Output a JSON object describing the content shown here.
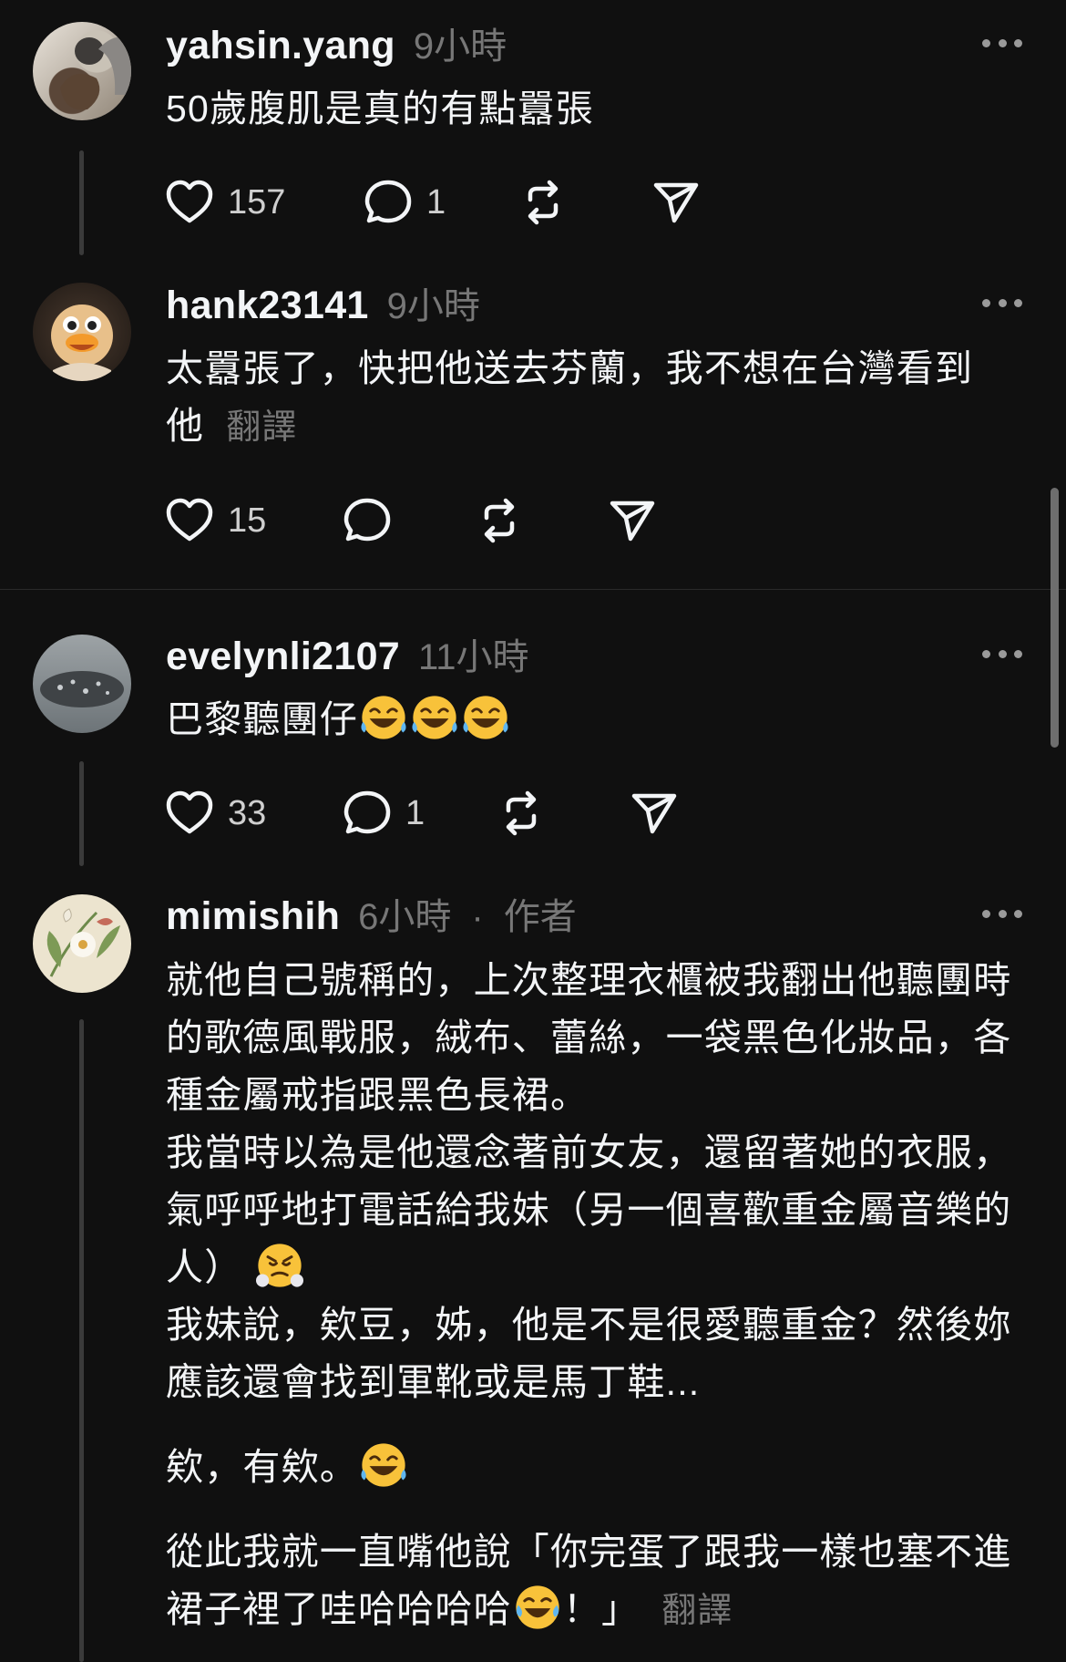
{
  "posts": [
    {
      "username": "yahsin.yang",
      "time": "9小時",
      "lines": [
        "50歲腹肌是真的有點囂張"
      ],
      "likes": "157",
      "replies": "1"
    },
    {
      "username": "hank23141",
      "time": "9小時",
      "lines": [
        "太囂張了，快把他送去芬蘭，我不想在台灣看到",
        "他"
      ],
      "translate": "翻譯",
      "likes": "15",
      "replies": ""
    },
    {
      "username": "evelynli2107",
      "time": "11小時",
      "lines": [
        "巴黎聽團仔"
      ],
      "likes": "33",
      "replies": "1"
    },
    {
      "username": "mimishih",
      "time": "6小時",
      "separator": "·",
      "author_badge": "作者",
      "lines": [
        "就他自己號稱的，上次整理衣櫃被我翻出他聽團時",
        "的歌德風戰服，絨布、蕾絲，一袋黑色化妝品，各",
        "種金屬戒指跟黑色長裙。",
        "我當時以為是他還念著前女友，還留著她的衣服，",
        "氣呼呼地打電話給我妹（另一個喜歡重金屬音樂的",
        "人）",
        "我妹說，欸豆，姊，他是不是很愛聽重金？然後妳",
        "應該還會找到軍靴或是馬丁鞋...",
        "欸，有欸。",
        "從此我就一直嘴他說「你完蛋了跟我一樣也塞不進",
        "裙子裡了哇哈哈哈哈",
        "！」"
      ],
      "translate": "翻譯"
    }
  ],
  "icons": {
    "like": "heart-icon",
    "reply": "comment-icon",
    "repost": "repost-icon",
    "share": "send-icon",
    "more": "more-icon",
    "emoji_laugh": "rolling-laughing-emoji",
    "emoji_huff": "huffing-emoji",
    "emoji_tears": "tears-of-joy-emoji"
  },
  "colors": {
    "background": "#101010",
    "text": "#f3f5f7",
    "muted": "#777777"
  }
}
